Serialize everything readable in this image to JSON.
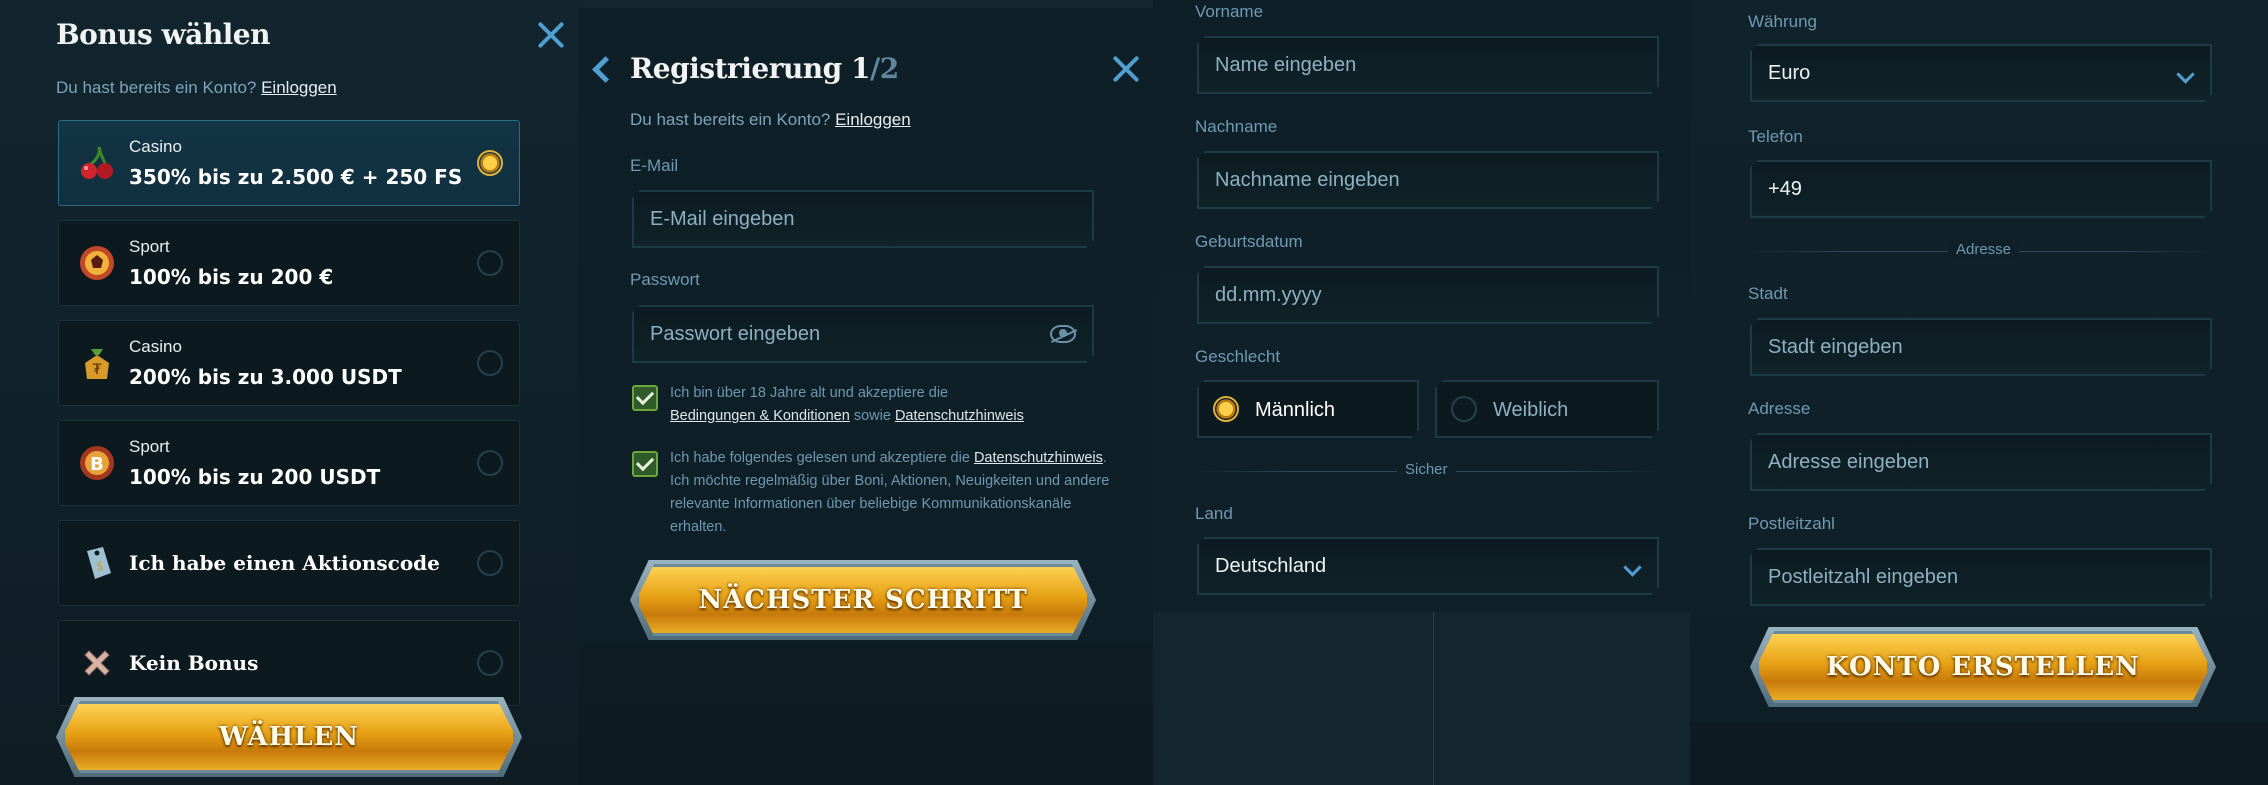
{
  "bonus": {
    "title": "Bonus wählen",
    "login_prompt": "Du hast bereits ein Konto?",
    "login_link": "Einloggen",
    "items": [
      {
        "category": "Casino",
        "offer": "350% bis zu 2.500 € + 250 FS",
        "selected": true
      },
      {
        "category": "Sport",
        "offer": "100% bis zu 200 €",
        "selected": false
      },
      {
        "category": "Casino",
        "offer": "200% bis zu 3.000 USDT",
        "selected": false
      },
      {
        "category": "Sport",
        "offer": "100% bis zu 200 USDT",
        "selected": false
      },
      {
        "category": "",
        "offer": "Ich habe einen Aktionscode",
        "selected": false
      },
      {
        "category": "",
        "offer": "Kein Bonus",
        "selected": false
      }
    ],
    "button": "WÄHLEN"
  },
  "register": {
    "title": "Registrierung 1",
    "step_total": "/2",
    "login_prompt": "Du hast bereits ein Konto?",
    "login_link": "Einloggen",
    "email_label": "E-Mail",
    "email_placeholder": "E-Mail eingeben",
    "password_label": "Passwort",
    "password_placeholder": "Passwort eingeben",
    "consent1_a": "Ich bin über 18 Jahre alt und akzeptiere die",
    "consent1_link1": "Bedingungen & Konditionen",
    "consent1_b": "sowie",
    "consent1_link2": "Datenschutzhinweis",
    "consent2_a": "Ich habe folgendes gelesen und akzeptiere die",
    "consent2_link": "Datenschutzhinweis",
    "consent2_b": "Ich möchte regelmäßig über Boni, Aktionen, Neuigkeiten und andere relevante Informationen über beliebige Kommunikationskanäle erhalten.",
    "button": "NÄCHSTER SCHRITT"
  },
  "personal": {
    "first_label": "Vorname",
    "first_placeholder": "Name eingeben",
    "last_label": "Nachname",
    "last_placeholder": "Nachname eingeben",
    "dob_label": "Geburtsdatum",
    "dob_placeholder": "dd.mm.yyyy",
    "gender_label": "Geschlecht",
    "gender_male": "Männlich",
    "gender_female": "Weiblich",
    "divider": "Sicher",
    "country_label": "Land",
    "country_value": "Deutschland"
  },
  "account": {
    "currency_label": "Währung",
    "currency_value": "Euro",
    "phone_label": "Telefon",
    "phone_value": "+49",
    "divider": "Adresse",
    "city_label": "Stadt",
    "city_placeholder": "Stadt eingeben",
    "address_label": "Adresse",
    "address_placeholder": "Adresse eingeben",
    "zip_label": "Postleitzahl",
    "zip_placeholder": "Postleitzahl eingeben",
    "button": "KONTO ERSTELLEN"
  },
  "colors": {
    "accent_blue": "#4f9fd0",
    "gold": "#e7a115",
    "check_green": "#6ea53d"
  }
}
